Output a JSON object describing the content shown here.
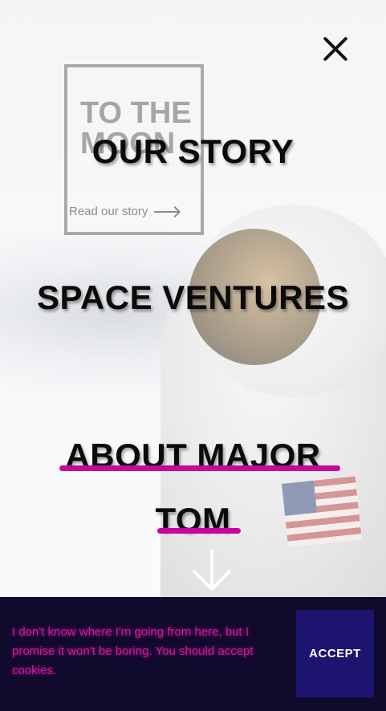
{
  "card": {
    "title": "TO THE MOON",
    "link_label": "Read our story"
  },
  "menu": {
    "items": [
      {
        "label": "OUR STORY"
      },
      {
        "label": "SPACE VENTURES"
      },
      {
        "label_line1": "ABOUT MAJOR",
        "label_line2": "TOM"
      }
    ],
    "active_index": 2,
    "accent_color": "#c4089e"
  },
  "icons": {
    "close": "close-icon",
    "scroll": "arrow-down-icon"
  },
  "cookie": {
    "message": "I don't know where I'm going from here, but I promise it won't be boring. You should accept cookies.",
    "accept_label": "ACCEPT",
    "background_color": "#100a2c",
    "button_color": "#1d1570",
    "text_color": "#cf1aa0"
  }
}
